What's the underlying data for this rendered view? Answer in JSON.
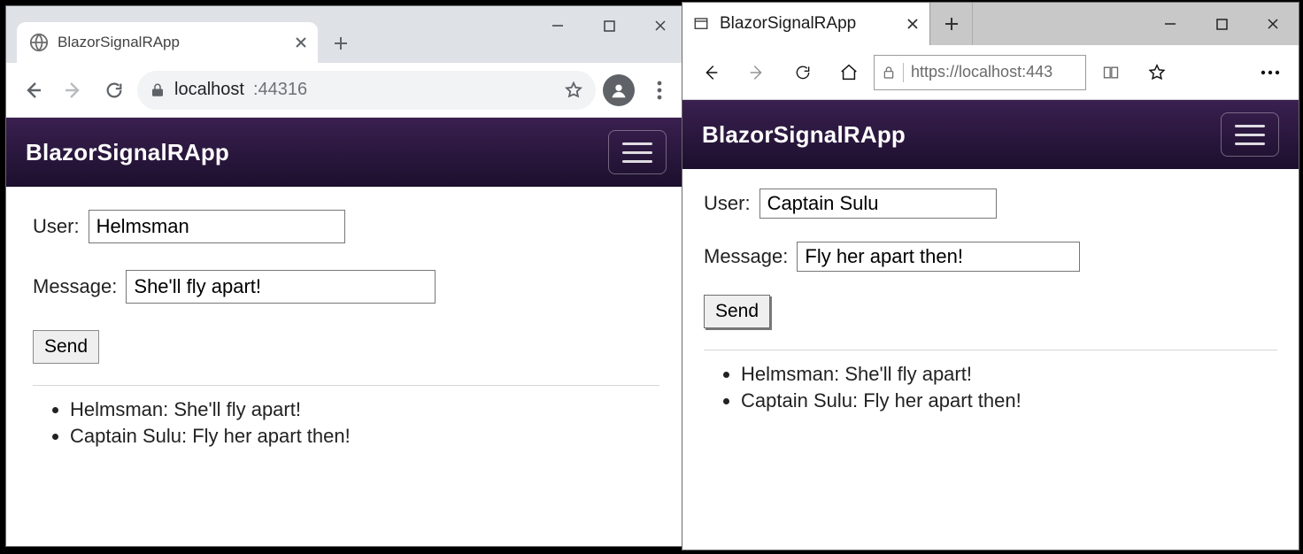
{
  "left": {
    "browser": "chrome",
    "tab_title": "BlazorSignalRApp",
    "url_host": "localhost",
    "url_port": ":44316",
    "nav_brand": "BlazorSignalRApp",
    "user_label": "User:",
    "user_value": "Helmsman",
    "message_label": "Message:",
    "message_value": "She'll fly apart!",
    "send_label": "Send",
    "messages": [
      "Helmsman: She'll fly apart!",
      "Captain Sulu: Fly her apart then!"
    ]
  },
  "right": {
    "browser": "edge",
    "tab_title": "BlazorSignalRApp",
    "url_display": "https://localhost:443",
    "nav_brand": "BlazorSignalRApp",
    "user_label": "User:",
    "user_value": "Captain Sulu",
    "message_label": "Message:",
    "message_value": "Fly her apart then!",
    "send_label": "Send",
    "messages": [
      "Helmsman: She'll fly apart!",
      "Captain Sulu: Fly her apart then!"
    ]
  }
}
